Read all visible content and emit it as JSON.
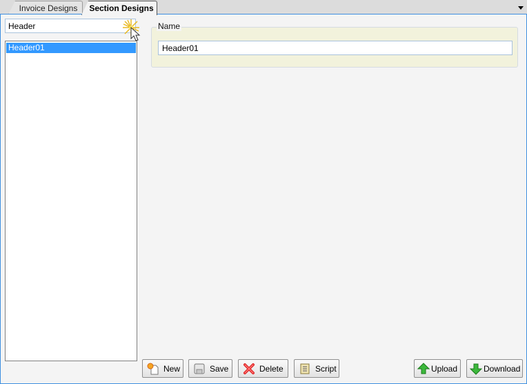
{
  "tabs": [
    {
      "label": "Invoice Designs",
      "active": false
    },
    {
      "label": "Section Designs",
      "active": true
    }
  ],
  "filter": {
    "value": "Header"
  },
  "list": {
    "items": [
      {
        "label": "Header01",
        "selected": true
      }
    ]
  },
  "details": {
    "group_label": "Name",
    "name_value": "Header01"
  },
  "buttons": {
    "new": "New",
    "save": "Save",
    "delete": "Delete",
    "script": "Script",
    "upload": "Upload",
    "download": "Download"
  },
  "icons": {
    "tab_menu": "dropdown-arrow-icon",
    "new": "new-document-icon",
    "save": "floppy-disk-icon",
    "delete": "red-x-icon",
    "script": "scroll-icon",
    "upload": "green-up-arrow-icon",
    "download": "green-down-arrow-icon"
  },
  "colors": {
    "accent_border": "#3d8fe0",
    "selection": "#3399ff",
    "group_bg": "#f2f2dc"
  }
}
